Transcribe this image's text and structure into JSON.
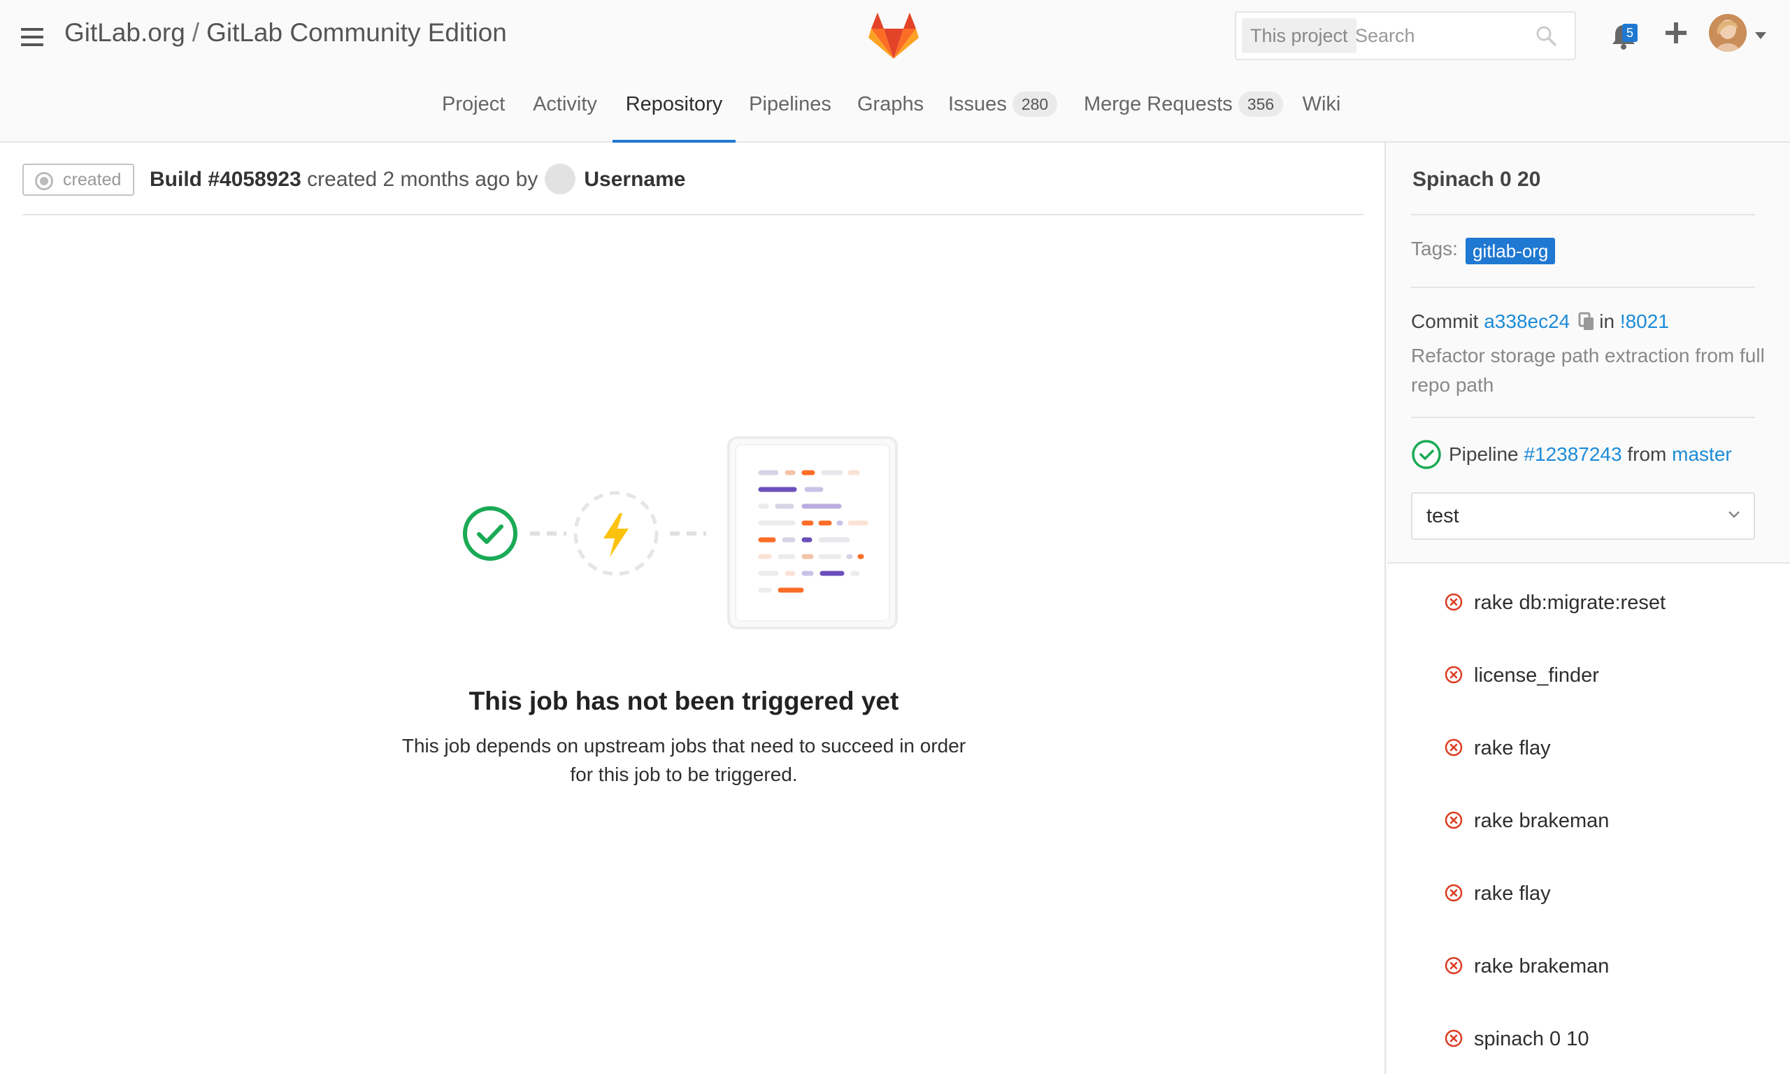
{
  "header": {
    "group": "GitLab.org",
    "separator": "/",
    "project": "GitLab Community Edition",
    "search_scope": "This project",
    "search_placeholder": "Search",
    "notification_count": "5"
  },
  "nav": [
    {
      "label": "Project"
    },
    {
      "label": "Activity"
    },
    {
      "label": "Repository",
      "active": true
    },
    {
      "label": "Pipelines"
    },
    {
      "label": "Graphs"
    },
    {
      "label": "Issues",
      "count": "280"
    },
    {
      "label": "Merge Requests",
      "count": "356"
    },
    {
      "label": "Wiki"
    }
  ],
  "build": {
    "status": "created",
    "title": "Build #4058923",
    "created_text": "created 2 months ago by",
    "username": "Username"
  },
  "empty_state": {
    "title": "This job has not been triggered yet",
    "description": "This job depends on upstream jobs that need to succeed in order for this job to be triggered."
  },
  "sidebar": {
    "title": "Spinach 0 20",
    "tags_label": "Tags:",
    "tag": "gitlab-org",
    "commit_label": "Commit",
    "commit_sha": "a338ec24",
    "in_label": "in",
    "merge_request": "!8021",
    "commit_message": "Refactor storage path extraction from full repo path",
    "pipeline_label": "Pipeline",
    "pipeline_id": "#12387243",
    "from_label": "from",
    "branch": "master",
    "stage": "test",
    "jobs": [
      "rake db:migrate:reset",
      "license_finder",
      "rake flay",
      "rake brakeman",
      "rake flay",
      "rake brakeman",
      "spinach 0 10"
    ]
  },
  "colors": {
    "accent": "#1f78d1",
    "link": "#1b8bd8",
    "success": "#1aaa55",
    "failed": "#db3b21",
    "warning": "#fc9403"
  }
}
